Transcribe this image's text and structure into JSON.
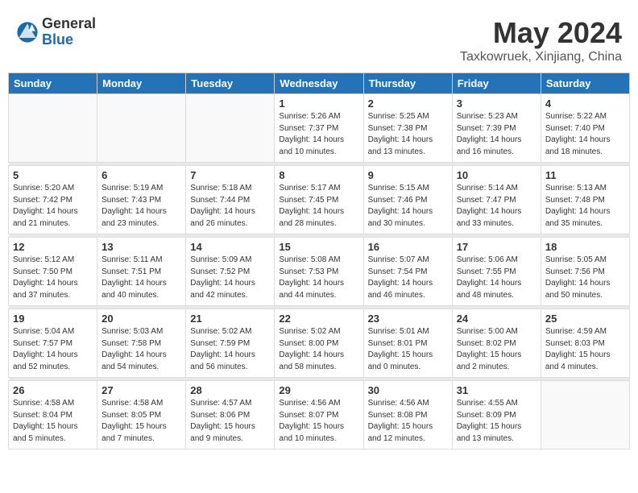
{
  "header": {
    "logo_general": "General",
    "logo_blue": "Blue",
    "month_title": "May 2024",
    "location": "Taxkowruek, Xinjiang, China"
  },
  "weekdays": [
    "Sunday",
    "Monday",
    "Tuesday",
    "Wednesday",
    "Thursday",
    "Friday",
    "Saturday"
  ],
  "weeks": [
    [
      {
        "day": "",
        "info": ""
      },
      {
        "day": "",
        "info": ""
      },
      {
        "day": "",
        "info": ""
      },
      {
        "day": "1",
        "info": "Sunrise: 5:26 AM\nSunset: 7:37 PM\nDaylight: 14 hours\nand 10 minutes."
      },
      {
        "day": "2",
        "info": "Sunrise: 5:25 AM\nSunset: 7:38 PM\nDaylight: 14 hours\nand 13 minutes."
      },
      {
        "day": "3",
        "info": "Sunrise: 5:23 AM\nSunset: 7:39 PM\nDaylight: 14 hours\nand 16 minutes."
      },
      {
        "day": "4",
        "info": "Sunrise: 5:22 AM\nSunset: 7:40 PM\nDaylight: 14 hours\nand 18 minutes."
      }
    ],
    [
      {
        "day": "5",
        "info": "Sunrise: 5:20 AM\nSunset: 7:42 PM\nDaylight: 14 hours\nand 21 minutes."
      },
      {
        "day": "6",
        "info": "Sunrise: 5:19 AM\nSunset: 7:43 PM\nDaylight: 14 hours\nand 23 minutes."
      },
      {
        "day": "7",
        "info": "Sunrise: 5:18 AM\nSunset: 7:44 PM\nDaylight: 14 hours\nand 26 minutes."
      },
      {
        "day": "8",
        "info": "Sunrise: 5:17 AM\nSunset: 7:45 PM\nDaylight: 14 hours\nand 28 minutes."
      },
      {
        "day": "9",
        "info": "Sunrise: 5:15 AM\nSunset: 7:46 PM\nDaylight: 14 hours\nand 30 minutes."
      },
      {
        "day": "10",
        "info": "Sunrise: 5:14 AM\nSunset: 7:47 PM\nDaylight: 14 hours\nand 33 minutes."
      },
      {
        "day": "11",
        "info": "Sunrise: 5:13 AM\nSunset: 7:48 PM\nDaylight: 14 hours\nand 35 minutes."
      }
    ],
    [
      {
        "day": "12",
        "info": "Sunrise: 5:12 AM\nSunset: 7:50 PM\nDaylight: 14 hours\nand 37 minutes."
      },
      {
        "day": "13",
        "info": "Sunrise: 5:11 AM\nSunset: 7:51 PM\nDaylight: 14 hours\nand 40 minutes."
      },
      {
        "day": "14",
        "info": "Sunrise: 5:09 AM\nSunset: 7:52 PM\nDaylight: 14 hours\nand 42 minutes."
      },
      {
        "day": "15",
        "info": "Sunrise: 5:08 AM\nSunset: 7:53 PM\nDaylight: 14 hours\nand 44 minutes."
      },
      {
        "day": "16",
        "info": "Sunrise: 5:07 AM\nSunset: 7:54 PM\nDaylight: 14 hours\nand 46 minutes."
      },
      {
        "day": "17",
        "info": "Sunrise: 5:06 AM\nSunset: 7:55 PM\nDaylight: 14 hours\nand 48 minutes."
      },
      {
        "day": "18",
        "info": "Sunrise: 5:05 AM\nSunset: 7:56 PM\nDaylight: 14 hours\nand 50 minutes."
      }
    ],
    [
      {
        "day": "19",
        "info": "Sunrise: 5:04 AM\nSunset: 7:57 PM\nDaylight: 14 hours\nand 52 minutes."
      },
      {
        "day": "20",
        "info": "Sunrise: 5:03 AM\nSunset: 7:58 PM\nDaylight: 14 hours\nand 54 minutes."
      },
      {
        "day": "21",
        "info": "Sunrise: 5:02 AM\nSunset: 7:59 PM\nDaylight: 14 hours\nand 56 minutes."
      },
      {
        "day": "22",
        "info": "Sunrise: 5:02 AM\nSunset: 8:00 PM\nDaylight: 14 hours\nand 58 minutes."
      },
      {
        "day": "23",
        "info": "Sunrise: 5:01 AM\nSunset: 8:01 PM\nDaylight: 15 hours\nand 0 minutes."
      },
      {
        "day": "24",
        "info": "Sunrise: 5:00 AM\nSunset: 8:02 PM\nDaylight: 15 hours\nand 2 minutes."
      },
      {
        "day": "25",
        "info": "Sunrise: 4:59 AM\nSunset: 8:03 PM\nDaylight: 15 hours\nand 4 minutes."
      }
    ],
    [
      {
        "day": "26",
        "info": "Sunrise: 4:58 AM\nSunset: 8:04 PM\nDaylight: 15 hours\nand 5 minutes."
      },
      {
        "day": "27",
        "info": "Sunrise: 4:58 AM\nSunset: 8:05 PM\nDaylight: 15 hours\nand 7 minutes."
      },
      {
        "day": "28",
        "info": "Sunrise: 4:57 AM\nSunset: 8:06 PM\nDaylight: 15 hours\nand 9 minutes."
      },
      {
        "day": "29",
        "info": "Sunrise: 4:56 AM\nSunset: 8:07 PM\nDaylight: 15 hours\nand 10 minutes."
      },
      {
        "day": "30",
        "info": "Sunrise: 4:56 AM\nSunset: 8:08 PM\nDaylight: 15 hours\nand 12 minutes."
      },
      {
        "day": "31",
        "info": "Sunrise: 4:55 AM\nSunset: 8:09 PM\nDaylight: 15 hours\nand 13 minutes."
      },
      {
        "day": "",
        "info": ""
      }
    ]
  ]
}
